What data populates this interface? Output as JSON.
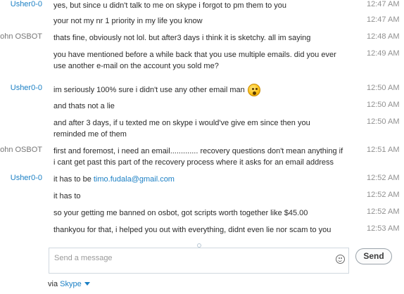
{
  "messages": [
    {
      "sender": "Usher0-0",
      "text": "yes, but since u didn't talk to me on skype i forgot to pm them to you",
      "time": "12:47 AM"
    },
    {
      "sender": "",
      "text": "your not my nr 1 priority in my life you know",
      "time": "12:47 AM"
    },
    {
      "sender": "john OSBOT",
      "text": "thats fine, obviously not lol. but after3 days i think it is sketchy. all im saying",
      "time": "12:48 AM"
    },
    {
      "sender": "",
      "text": "you have mentioned before a while back that you use multiple emails. did you ever use another e-mail on the account you sold me?",
      "time": "12:49 AM"
    },
    {
      "sender": "Usher0-0",
      "text": "im seriously 100% sure i didn't use any other email man",
      "time": "12:50 AM",
      "emoticon": "surprised-emoticon"
    },
    {
      "sender": "",
      "text": "and thats not a lie",
      "time": "12:50 AM"
    },
    {
      "sender": "",
      "text": "and after 3 days, if u texted me on skype i would've give em since then you reminded me of them",
      "time": "12:50 AM"
    },
    {
      "sender": "john OSBOT",
      "text": "first and foremost, i need an email............. recovery questions don't mean anything if i cant get past this part of the recovery process where it asks for an email address",
      "time": "12:51 AM"
    },
    {
      "sender": "Usher0-0",
      "text_prefix": "it has to be ",
      "email": "timo.fudala@gmail.com",
      "time": "12:52 AM"
    },
    {
      "sender": "",
      "text": "it has to",
      "time": "12:52 AM"
    },
    {
      "sender": "",
      "text": "so your getting me banned on osbot, got scripts worth together like $45.00",
      "time": "12:52 AM"
    },
    {
      "sender": "",
      "text": "thankyou for that, i helped you out with everything, didnt even lie nor scam to you",
      "time": "12:53 AM"
    }
  ],
  "compose": {
    "placeholder": "Send a message",
    "value": ""
  },
  "send_label": "Send",
  "via": {
    "prefix": "via ",
    "service": "Skype"
  },
  "colors": {
    "sender_blue": "#1a7fc4",
    "sender_grey": "#777777",
    "time_grey": "#909090"
  }
}
